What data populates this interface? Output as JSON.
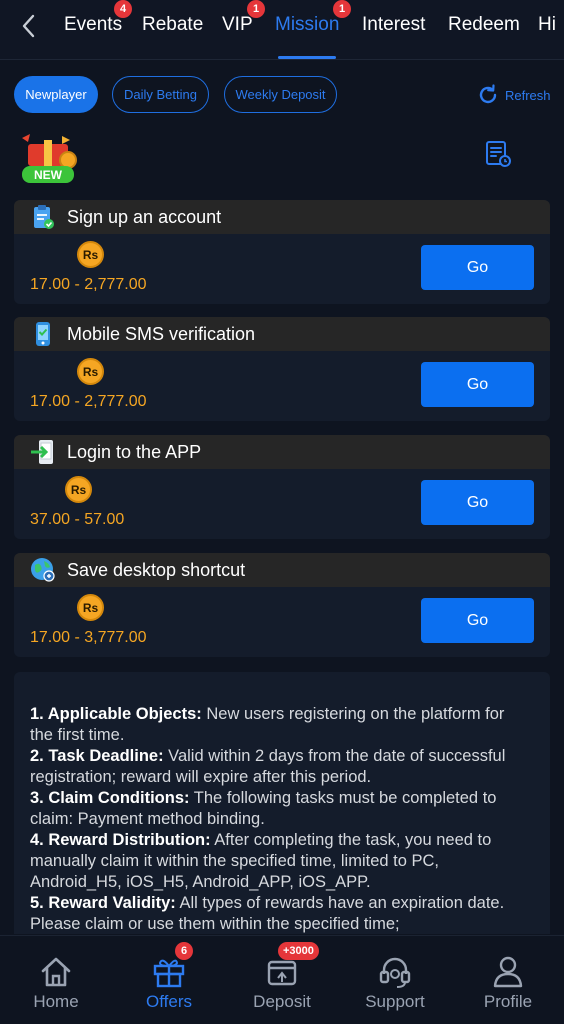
{
  "tabs": [
    {
      "label": "Events",
      "badge": "4"
    },
    {
      "label": "Rebate",
      "badge": ""
    },
    {
      "label": "VIP",
      "badge": "1"
    },
    {
      "label": "Mission",
      "badge": "1"
    },
    {
      "label": "Interest",
      "badge": ""
    },
    {
      "label": "Redeem",
      "badge": ""
    },
    {
      "label": "Hi",
      "badge": ""
    }
  ],
  "filters": {
    "newplayer": "Newplayer",
    "daily_betting": "Daily Betting",
    "weekly_deposit": "Weekly Deposit",
    "refresh": "Refresh"
  },
  "new_badge": "NEW",
  "currency_symbol": "Rs",
  "tasks": [
    {
      "title": "Sign up an account",
      "range": "17.00 - 2,777.00",
      "button": "Go"
    },
    {
      "title": "Mobile SMS verification",
      "range": "17.00 - 2,777.00",
      "button": "Go"
    },
    {
      "title": "Login to the APP",
      "range": "37.00 - 57.00",
      "button": "Go"
    },
    {
      "title": "Save desktop shortcut",
      "range": "17.00 - 3,777.00",
      "button": "Go"
    }
  ],
  "rules": [
    {
      "label": "1. Applicable Objects:",
      "text": " New users registering on the platform for the first time."
    },
    {
      "label": "2. Task Deadline:",
      "text": " Valid within 2 days from the date of successful registration; reward will expire after this period."
    },
    {
      "label": "3. Claim Conditions:",
      "text": " The following tasks must be completed to claim: Payment method binding."
    },
    {
      "label": "4. Reward Distribution:",
      "text": " After completing the task, you need to manually claim it within the specified time, limited to PC, Android_H5, iOS_H5, Android_APP, iOS_APP."
    },
    {
      "label": "5. Reward Validity:",
      "text": " All types of rewards have an expiration date. Please claim or use them within the specified time;"
    }
  ],
  "nav": [
    {
      "label": "Home",
      "badge": ""
    },
    {
      "label": "Offers",
      "badge": "6"
    },
    {
      "label": "Deposit",
      "badge": "+3000"
    },
    {
      "label": "Support",
      "badge": ""
    },
    {
      "label": "Profile",
      "badge": ""
    }
  ],
  "colors": {
    "accent": "#2d7bf0",
    "gold": "#f5a623",
    "badge_red": "#e5363a",
    "background": "#0e1420"
  }
}
